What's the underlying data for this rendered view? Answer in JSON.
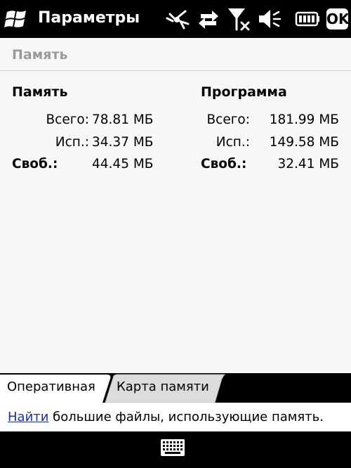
{
  "titlebar": {
    "app_title": "Параметры",
    "ok_label": "OK",
    "icons": [
      "windows-start-icon",
      "connectivity-icon",
      "data-transfer-icon",
      "no-signal-icon",
      "speaker-volume-icon",
      "battery-icon"
    ]
  },
  "page": {
    "header_title": "Память"
  },
  "memory": {
    "title": "Память",
    "rows": [
      {
        "label": "Всего:",
        "value": "78.81 МБ"
      },
      {
        "label": "Исп.:",
        "value": "34.37 МБ"
      },
      {
        "label": "Своб.:",
        "value": "44.45 МБ"
      }
    ]
  },
  "program": {
    "title": "Программа",
    "rows": [
      {
        "label": "Всего:",
        "value": "181.99 МБ"
      },
      {
        "label": "Исп.:",
        "value": "149.58 МБ"
      },
      {
        "label": "Своб.:",
        "value": "32.41 МБ"
      }
    ]
  },
  "tabs": [
    {
      "label": "Оперативная",
      "active": true
    },
    {
      "label": "Карта памяти",
      "active": false
    }
  ],
  "footer": {
    "link_text": "Найти",
    "rest_text": " большие файлы, использующие память."
  },
  "softkeys": {
    "icon": "keyboard-icon"
  },
  "colors": {
    "bar_bg": "#000000",
    "page_bg": "#f7f7f7",
    "link": "#1a2cc0",
    "header_text": "#9a9a9a",
    "inactive_tab": "#dcdcdc"
  }
}
